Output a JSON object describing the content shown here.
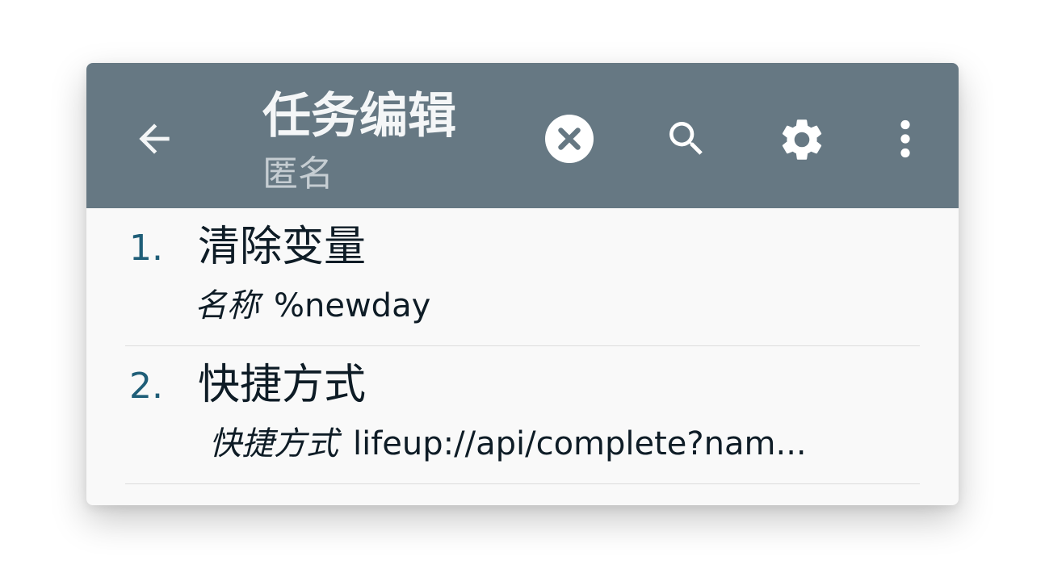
{
  "toolbar": {
    "title": "任务编辑",
    "subtitle": "匿名",
    "icons": {
      "back": "arrow-back-icon",
      "clear": "clear-circle-icon",
      "search": "search-icon",
      "settings": "gear-icon",
      "more": "more-vert-icon"
    },
    "background_color": "#667883"
  },
  "actions": [
    {
      "number": "1.",
      "name": "清除变量",
      "param_label": "名称",
      "param_value": "%newday"
    },
    {
      "number": "2.",
      "name": "快捷方式",
      "param_label": "快捷方式",
      "param_value": "lifeup://api/complete?nam..."
    }
  ],
  "colors": {
    "number": "#1f5e78",
    "text": "#0e1c26",
    "list_background": "#f9f9f9"
  }
}
